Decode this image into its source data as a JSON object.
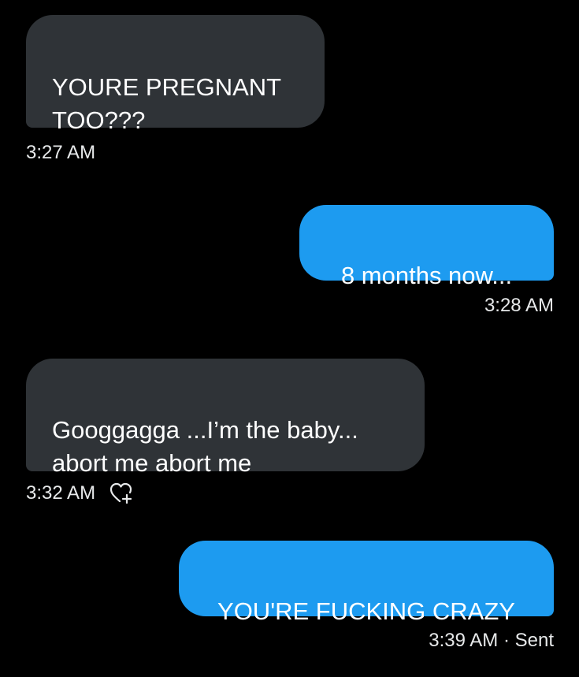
{
  "messages": [
    {
      "direction": "received",
      "text": "YOURE PREGNANT\nTOO???",
      "time": "3:27 AM"
    },
    {
      "direction": "sent",
      "text": "8 months now...",
      "time": "3:28 AM"
    },
    {
      "direction": "received",
      "text": "Googgagga ...I’m the baby...\nabort me abort me",
      "time": "3:32 AM",
      "reaction_icon": "heart-plus-icon"
    },
    {
      "direction": "sent",
      "text": "YOU'RE FUCKING CRAZY",
      "time": "3:39 AM · Sent"
    }
  ],
  "colors": {
    "background": "#000000",
    "received_bubble": "#2f3337",
    "sent_bubble": "#1d9bf0",
    "text": "#ffffff"
  }
}
